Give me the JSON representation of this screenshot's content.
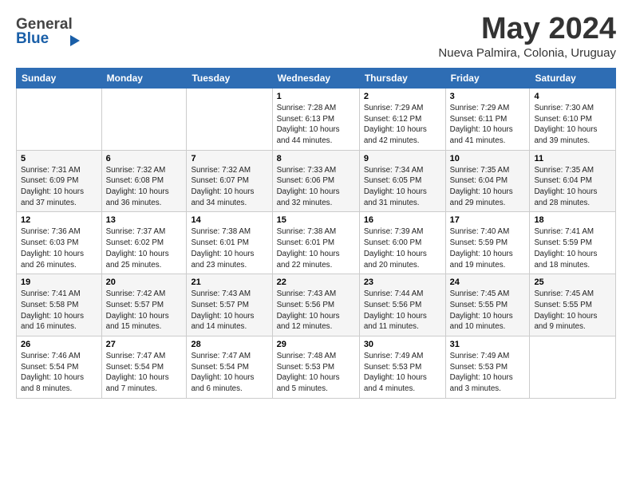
{
  "logo": {
    "line1": "General",
    "line2": "Blue"
  },
  "title": {
    "month_year": "May 2024",
    "location": "Nueva Palmira, Colonia, Uruguay"
  },
  "weekdays": [
    "Sunday",
    "Monday",
    "Tuesday",
    "Wednesday",
    "Thursday",
    "Friday",
    "Saturday"
  ],
  "weeks": [
    [
      {
        "day": "",
        "info": ""
      },
      {
        "day": "",
        "info": ""
      },
      {
        "day": "",
        "info": ""
      },
      {
        "day": "1",
        "info": "Sunrise: 7:28 AM\nSunset: 6:13 PM\nDaylight: 10 hours\nand 44 minutes."
      },
      {
        "day": "2",
        "info": "Sunrise: 7:29 AM\nSunset: 6:12 PM\nDaylight: 10 hours\nand 42 minutes."
      },
      {
        "day": "3",
        "info": "Sunrise: 7:29 AM\nSunset: 6:11 PM\nDaylight: 10 hours\nand 41 minutes."
      },
      {
        "day": "4",
        "info": "Sunrise: 7:30 AM\nSunset: 6:10 PM\nDaylight: 10 hours\nand 39 minutes."
      }
    ],
    [
      {
        "day": "5",
        "info": "Sunrise: 7:31 AM\nSunset: 6:09 PM\nDaylight: 10 hours\nand 37 minutes."
      },
      {
        "day": "6",
        "info": "Sunrise: 7:32 AM\nSunset: 6:08 PM\nDaylight: 10 hours\nand 36 minutes."
      },
      {
        "day": "7",
        "info": "Sunrise: 7:32 AM\nSunset: 6:07 PM\nDaylight: 10 hours\nand 34 minutes."
      },
      {
        "day": "8",
        "info": "Sunrise: 7:33 AM\nSunset: 6:06 PM\nDaylight: 10 hours\nand 32 minutes."
      },
      {
        "day": "9",
        "info": "Sunrise: 7:34 AM\nSunset: 6:05 PM\nDaylight: 10 hours\nand 31 minutes."
      },
      {
        "day": "10",
        "info": "Sunrise: 7:35 AM\nSunset: 6:04 PM\nDaylight: 10 hours\nand 29 minutes."
      },
      {
        "day": "11",
        "info": "Sunrise: 7:35 AM\nSunset: 6:04 PM\nDaylight: 10 hours\nand 28 minutes."
      }
    ],
    [
      {
        "day": "12",
        "info": "Sunrise: 7:36 AM\nSunset: 6:03 PM\nDaylight: 10 hours\nand 26 minutes."
      },
      {
        "day": "13",
        "info": "Sunrise: 7:37 AM\nSunset: 6:02 PM\nDaylight: 10 hours\nand 25 minutes."
      },
      {
        "day": "14",
        "info": "Sunrise: 7:38 AM\nSunset: 6:01 PM\nDaylight: 10 hours\nand 23 minutes."
      },
      {
        "day": "15",
        "info": "Sunrise: 7:38 AM\nSunset: 6:01 PM\nDaylight: 10 hours\nand 22 minutes."
      },
      {
        "day": "16",
        "info": "Sunrise: 7:39 AM\nSunset: 6:00 PM\nDaylight: 10 hours\nand 20 minutes."
      },
      {
        "day": "17",
        "info": "Sunrise: 7:40 AM\nSunset: 5:59 PM\nDaylight: 10 hours\nand 19 minutes."
      },
      {
        "day": "18",
        "info": "Sunrise: 7:41 AM\nSunset: 5:59 PM\nDaylight: 10 hours\nand 18 minutes."
      }
    ],
    [
      {
        "day": "19",
        "info": "Sunrise: 7:41 AM\nSunset: 5:58 PM\nDaylight: 10 hours\nand 16 minutes."
      },
      {
        "day": "20",
        "info": "Sunrise: 7:42 AM\nSunset: 5:57 PM\nDaylight: 10 hours\nand 15 minutes."
      },
      {
        "day": "21",
        "info": "Sunrise: 7:43 AM\nSunset: 5:57 PM\nDaylight: 10 hours\nand 14 minutes."
      },
      {
        "day": "22",
        "info": "Sunrise: 7:43 AM\nSunset: 5:56 PM\nDaylight: 10 hours\nand 12 minutes."
      },
      {
        "day": "23",
        "info": "Sunrise: 7:44 AM\nSunset: 5:56 PM\nDaylight: 10 hours\nand 11 minutes."
      },
      {
        "day": "24",
        "info": "Sunrise: 7:45 AM\nSunset: 5:55 PM\nDaylight: 10 hours\nand 10 minutes."
      },
      {
        "day": "25",
        "info": "Sunrise: 7:45 AM\nSunset: 5:55 PM\nDaylight: 10 hours\nand 9 minutes."
      }
    ],
    [
      {
        "day": "26",
        "info": "Sunrise: 7:46 AM\nSunset: 5:54 PM\nDaylight: 10 hours\nand 8 minutes."
      },
      {
        "day": "27",
        "info": "Sunrise: 7:47 AM\nSunset: 5:54 PM\nDaylight: 10 hours\nand 7 minutes."
      },
      {
        "day": "28",
        "info": "Sunrise: 7:47 AM\nSunset: 5:54 PM\nDaylight: 10 hours\nand 6 minutes."
      },
      {
        "day": "29",
        "info": "Sunrise: 7:48 AM\nSunset: 5:53 PM\nDaylight: 10 hours\nand 5 minutes."
      },
      {
        "day": "30",
        "info": "Sunrise: 7:49 AM\nSunset: 5:53 PM\nDaylight: 10 hours\nand 4 minutes."
      },
      {
        "day": "31",
        "info": "Sunrise: 7:49 AM\nSunset: 5:53 PM\nDaylight: 10 hours\nand 3 minutes."
      },
      {
        "day": "",
        "info": ""
      }
    ]
  ]
}
